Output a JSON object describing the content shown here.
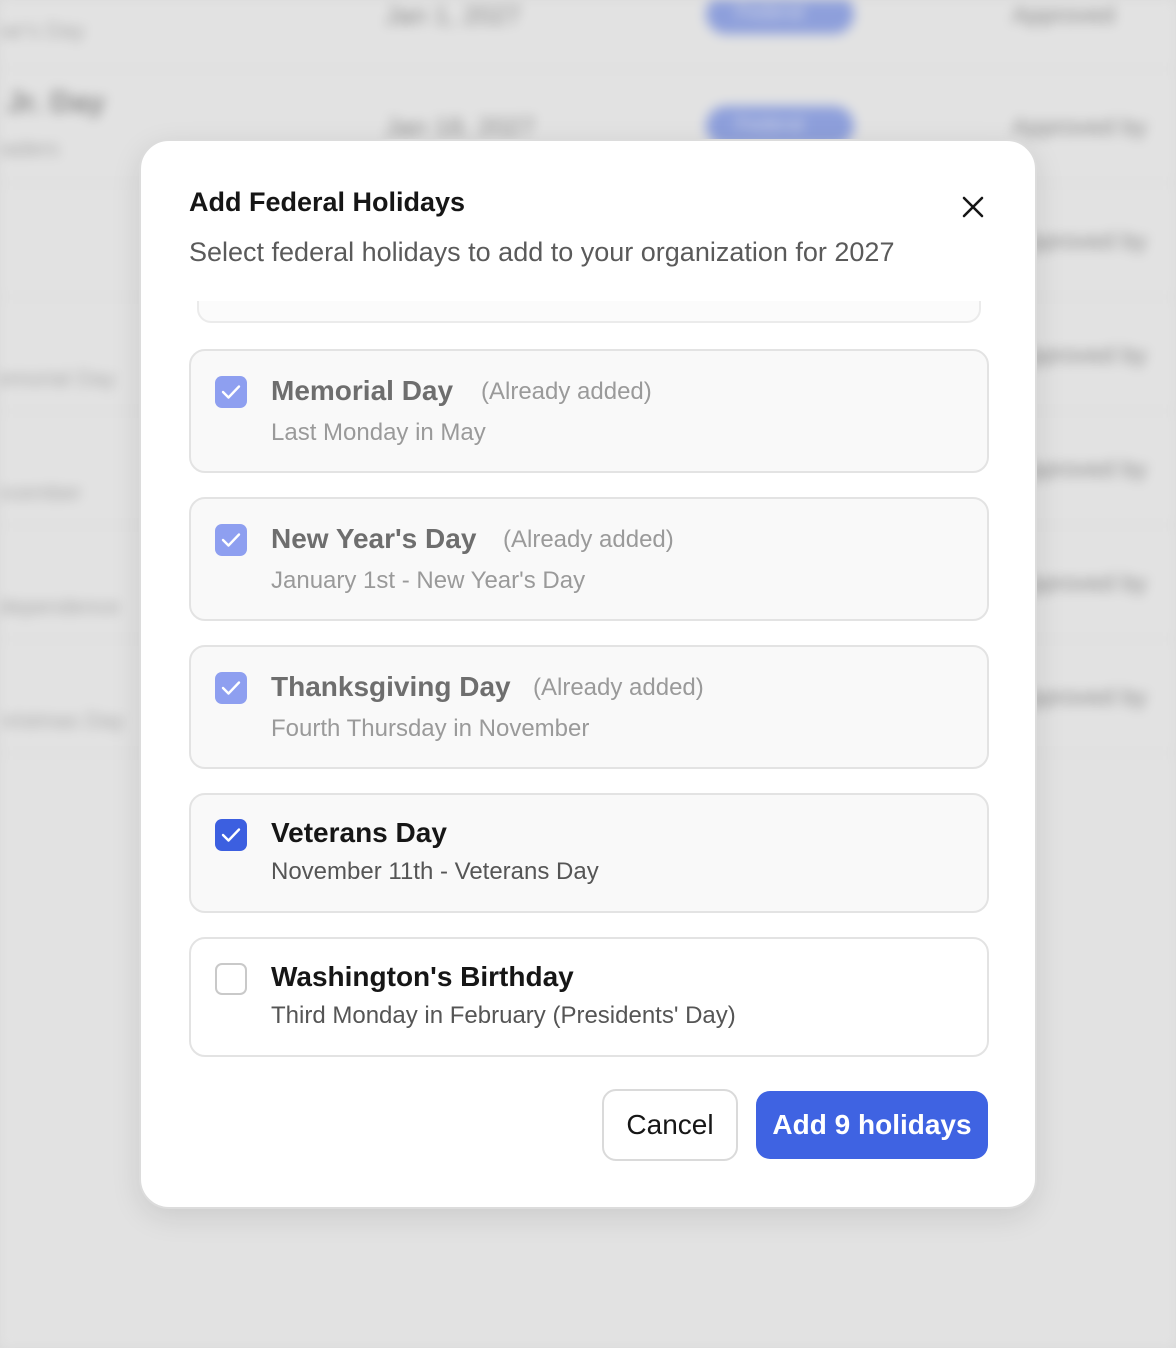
{
  "background": {
    "rows": [
      {
        "name": "",
        "sub": "Year's Day",
        "date": "Jan 1, 2027",
        "pill": "Federal",
        "status": "Approved"
      },
      {
        "name": "g Jr. Day",
        "sub": "Leaders",
        "date": "Jan 18, 2027",
        "pill": "Federal",
        "status": "Approved by"
      },
      {
        "name": "",
        "sub": "",
        "date": "",
        "pill": "",
        "status": "Approved by"
      },
      {
        "name": "y",
        "sub": "Memorial Day",
        "date": "",
        "pill": "",
        "status": "Approved by"
      },
      {
        "name": "",
        "sub": "December",
        "date": "",
        "pill": "",
        "status": "Approved by"
      },
      {
        "name": "y",
        "sub": "Independence",
        "date": "",
        "pill": "",
        "status": "Approved by"
      },
      {
        "name": "",
        "sub": "Christmas Day",
        "date": "",
        "pill": "",
        "status": "Approved by"
      }
    ]
  },
  "modal": {
    "title": "Add Federal Holidays",
    "subtitle": "Select federal holidays to add to your organization for 2027",
    "close_icon": "close-icon",
    "already_added_label": "(Already added)",
    "holidays": [
      {
        "name": "Memorial Day",
        "desc": "Last Monday in May",
        "state": "already-added",
        "badge": "(Already added)"
      },
      {
        "name": "New Year's Day",
        "desc": "January 1st - New Year's Day",
        "state": "already-added",
        "badge": "(Already added)"
      },
      {
        "name": "Thanksgiving Day",
        "desc": "Fourth Thursday in November",
        "state": "already-added",
        "badge": "(Already added)"
      },
      {
        "name": "Veterans Day",
        "desc": "November 11th - Veterans Day",
        "state": "checked"
      },
      {
        "name": "Washington's Birthday",
        "desc": "Third Monday in February (Presidents' Day)",
        "state": "unchecked"
      }
    ],
    "cancel_label": "Cancel",
    "submit_label": "Add 9 holidays"
  },
  "colors": {
    "primary": "#3f63e2",
    "checkbox_checked": "#3c5fe0",
    "checkbox_disabled": "#8e9ff0"
  }
}
